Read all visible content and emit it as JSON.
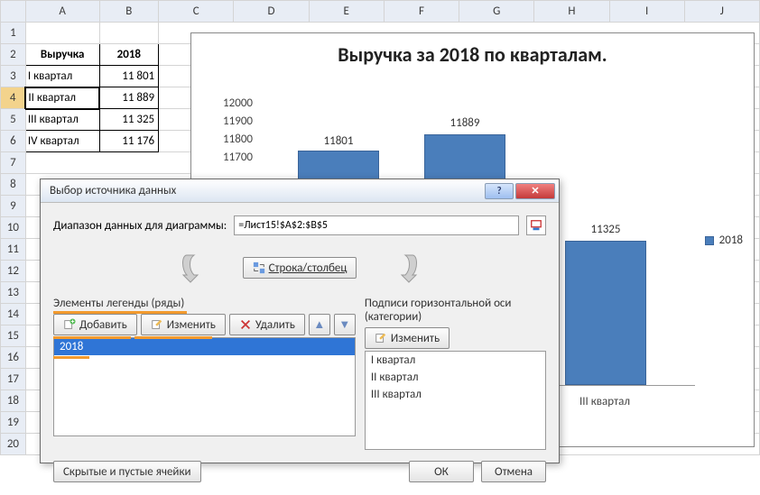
{
  "grid": {
    "columns": [
      "A",
      "B",
      "C",
      "D",
      "E",
      "F",
      "G",
      "H",
      "I",
      "J"
    ],
    "rows_visible": 20,
    "selected_row": 4,
    "head": {
      "A": "Выручка",
      "B": "2018"
    },
    "body": [
      {
        "A": "I квартал",
        "B": "11 801"
      },
      {
        "A": "II квартал",
        "B": "11 889"
      },
      {
        "A": "III квартал",
        "B": "11 325"
      },
      {
        "A": "IV квартал",
        "B": "11 176"
      }
    ]
  },
  "chart_data": {
    "type": "bar",
    "title": "Выручка за 2018 по кварталам.",
    "categories": [
      "I квартал",
      "II квартал",
      "III квартал"
    ],
    "values": [
      11801,
      11889,
      11325
    ],
    "yticks": [
      12000,
      11900,
      11800,
      11700
    ],
    "ylim": [
      11000,
      12000
    ],
    "ylabel": "",
    "xlabel": "",
    "legend": [
      "2018"
    ],
    "visible_x_label": "III квартал"
  },
  "dialog": {
    "title": "Выбор источника данных",
    "range_label": "Диапазон данных для диаграммы:",
    "range_value": "=Лист15!$A$2:$B$5",
    "switch_label": "Строка/столбец",
    "legend_group": "Элементы легенды (ряды)",
    "legend_buttons": {
      "add": "Добавить",
      "edit": "Изменить",
      "delete": "Удалить"
    },
    "legend_items": [
      "2018"
    ],
    "axis_group": "Подписи горизонтальной оси (категории)",
    "axis_buttons": {
      "edit": "Изменить"
    },
    "axis_items": [
      "I квартал",
      "II квартал",
      "III квартал"
    ],
    "hidden_cells_label": "Скрытые и пустые ячейки",
    "ok": "ОК",
    "cancel": "Отмена"
  }
}
